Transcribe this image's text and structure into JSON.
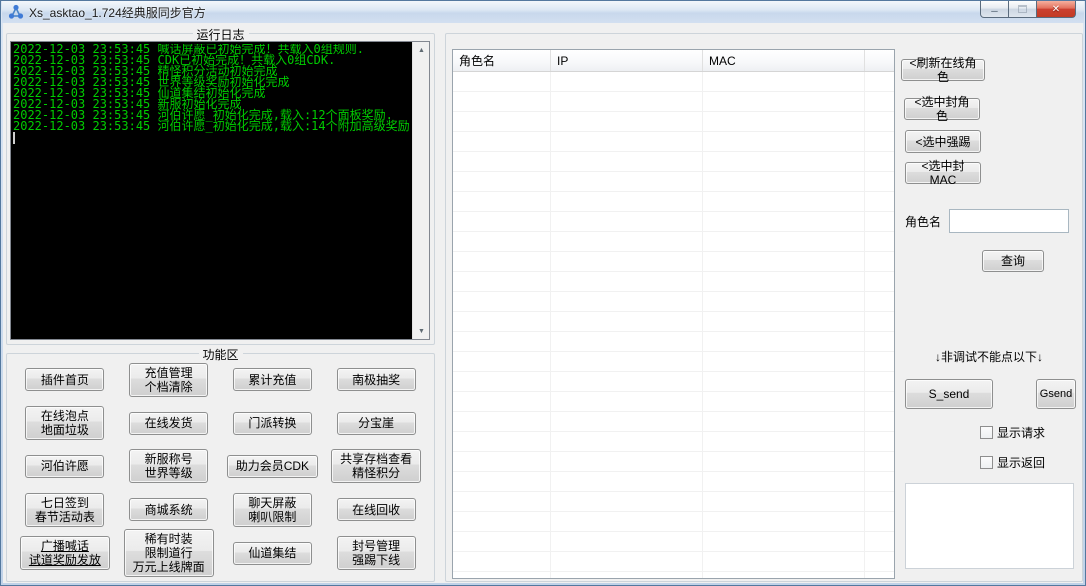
{
  "window": {
    "title": "Xs_asktao_1.724经典服同步官方"
  },
  "icons": {
    "minimize": "─",
    "close": "✕",
    "scroll_up": "▲",
    "scroll_down": "▼"
  },
  "colors": {
    "log_bg": "#000000",
    "log_text": "#00cc00",
    "close_button_red": "#c23b24"
  },
  "run_log": {
    "group_title": "运行日志",
    "lines": [
      {
        "time": "2022-12-03 23:53:45",
        "message": "喊话屏蔽已初始完成！共载入0组规则."
      },
      {
        "time": "2022-12-03 23:53:45",
        "message": "CDK已初始完成！共载入0组CDK."
      },
      {
        "time": "2022-12-03 23:53:45",
        "message": "精怪积分活动初始完成"
      },
      {
        "time": "2022-12-03 23:53:45",
        "message": "世界等级奖励初始化完成"
      },
      {
        "time": "2022-12-03 23:53:45",
        "message": "仙道集结初始化完成"
      },
      {
        "time": "2022-12-03 23:53:45",
        "message": "新服初始化完成"
      },
      {
        "time": "2022-12-03 23:53:45",
        "message": "河伯许愿_初始化完成,载入:12个面板奖励."
      },
      {
        "time": "2022-12-03 23:53:45",
        "message": "河伯许愿_初始化完成,载入:14个附加高级奖励."
      }
    ]
  },
  "function_area": {
    "group_title": "功能区",
    "buttons": [
      {
        "label": "插件首页"
      },
      {
        "label": "充值管理\n个档清除"
      },
      {
        "label": "累计充值"
      },
      {
        "label": "南极抽奖"
      },
      {
        "label": "在线泡点\n地面垃圾"
      },
      {
        "label": "在线发货"
      },
      {
        "label": "门派转换"
      },
      {
        "label": "分宝崖"
      },
      {
        "label": "河伯许愿"
      },
      {
        "label": "新服称号\n世界等级"
      },
      {
        "label": "助力会员CDK"
      },
      {
        "label": "共享存档查看\n精怪积分"
      },
      {
        "label": "七日签到\n春节活动表"
      },
      {
        "label": "商城系统"
      },
      {
        "label": "聊天屏蔽\n喇叭限制"
      },
      {
        "label": "在线回收"
      },
      {
        "label": "广播喊话\n试道奖励发放",
        "underline": true
      },
      {
        "label": "稀有时装\n限制道行\n万元上线牌面"
      },
      {
        "label": "仙道集结"
      },
      {
        "label": "封号管理\n强踢下线"
      }
    ]
  },
  "online_panel": {
    "table": {
      "columns": [
        "角色名",
        "IP",
        "MAC"
      ]
    },
    "action_buttons": [
      {
        "label": "<刷新在线角色"
      },
      {
        "label": "<选中封角色"
      },
      {
        "label": "<选中强踢"
      },
      {
        "label": "<选中封MAC"
      }
    ],
    "role_name_label": "角色名",
    "role_name_value": "",
    "query_button": "查询",
    "debug_warning": "↓非调试不能点以下↓",
    "s_send_button": "S_send",
    "g_send_button": "Gsend",
    "checkboxes": [
      {
        "label": "显示请求",
        "checked": false
      },
      {
        "label": "显示返回",
        "checked": false
      }
    ],
    "debug_output": ""
  }
}
